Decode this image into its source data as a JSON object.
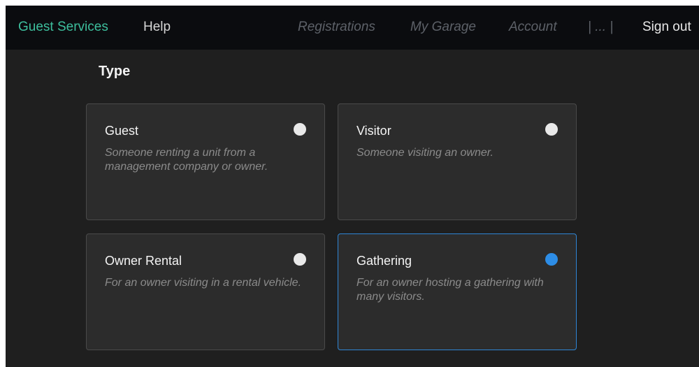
{
  "nav": {
    "brand": "Guest Services",
    "help": "Help",
    "registrations": "Registrations",
    "my_garage": "My Garage",
    "account": "Account",
    "ellipsis": "| ... |",
    "sign_out": "Sign out"
  },
  "section_title": "Type",
  "options": [
    {
      "title": "Guest",
      "description": "Someone renting a unit from a management company or owner.",
      "selected": false
    },
    {
      "title": "Visitor",
      "description": "Someone visiting an owner.",
      "selected": false
    },
    {
      "title": "Owner Rental",
      "description": "For an owner visiting in a rental vehicle.",
      "selected": false
    },
    {
      "title": "Gathering",
      "description": "For an owner hosting a gathering with many visitors.",
      "selected": true
    }
  ],
  "colors": {
    "brand": "#3dbf9d",
    "selected": "#2d8de6",
    "background": "#1f1f1f",
    "card": "#2c2c2c"
  }
}
